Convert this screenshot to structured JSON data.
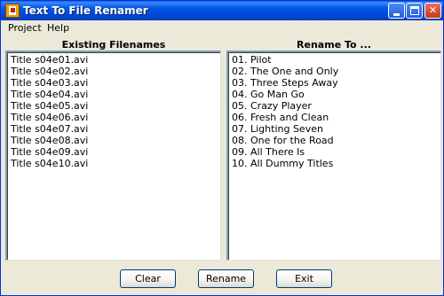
{
  "window": {
    "title": "Text To File Renamer"
  },
  "menu": {
    "items": [
      "Project",
      "Help"
    ]
  },
  "existing": {
    "header": "Existing Filenames",
    "items": [
      "Title s04e01.avi",
      "Title s04e02.avi",
      "Title s04e03.avi",
      "Title s04e04.avi",
      "Title s04e05.avi",
      "Title s04e06.avi",
      "Title s04e07.avi",
      "Title s04e08.avi",
      "Title s04e09.avi",
      "Title s04e10.avi"
    ]
  },
  "rename": {
    "header": "Rename To ...",
    "items": [
      "01. Pilot",
      "02. The One and Only",
      "03. Three Steps Away",
      "04. Go Man Go",
      "05. Crazy Player",
      "06. Fresh and Clean",
      "07. Lighting Seven",
      "08. One for the Road",
      "09. All There Is",
      "10. All Dummy Titles"
    ]
  },
  "buttons": {
    "clear": "Clear",
    "rename": "Rename",
    "exit": "Exit"
  },
  "colors": {
    "titlebar": "#0058e6",
    "window_bg": "#ece9d8",
    "close_button": "#d9481f"
  }
}
